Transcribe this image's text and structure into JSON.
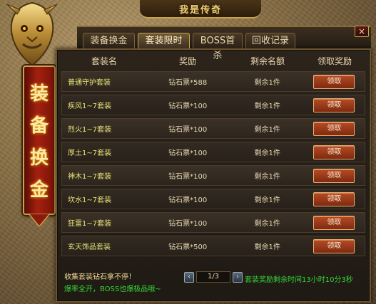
{
  "top_title": "我是传奇",
  "banner_chars": [
    "装",
    "备",
    "换",
    "金"
  ],
  "close_label": "×",
  "tabs": [
    {
      "label": "装备换金",
      "active": false
    },
    {
      "label": "套装限时",
      "active": true
    },
    {
      "label": "BOSS首杀",
      "active": false
    },
    {
      "label": "回收记录",
      "active": false
    }
  ],
  "table": {
    "headers": [
      "套装名",
      "奖励",
      "剩余名额",
      "领取奖励"
    ],
    "rows": [
      {
        "name": "普通守护套装",
        "reward": "钻石票*588",
        "remaining": "剩余1件",
        "button": "领取"
      },
      {
        "name": "疾风1~7套装",
        "reward": "钻石票*100",
        "remaining": "剩余1件",
        "button": "领取"
      },
      {
        "name": "烈火1~7套装",
        "reward": "钻石票*100",
        "remaining": "剩余1件",
        "button": "领取"
      },
      {
        "name": "厚土1~7套装",
        "reward": "钻石票*100",
        "remaining": "剩余1件",
        "button": "领取"
      },
      {
        "name": "神木1~7套装",
        "reward": "钻石票*100",
        "remaining": "剩余1件",
        "button": "领取"
      },
      {
        "name": "坎水1~7套装",
        "reward": "钻石票*100",
        "remaining": "剩余1件",
        "button": "领取"
      },
      {
        "name": "狂雷1~7套装",
        "reward": "钻石票*100",
        "remaining": "剩余1件",
        "button": "领取"
      },
      {
        "name": "玄天饰品套装",
        "reward": "钻石票*500",
        "remaining": "剩余1件",
        "button": "领取"
      }
    ]
  },
  "footer": {
    "msg1": "收集套装钻石拿不停！",
    "msg2": "爆率全开，BOSS也爆极品哦~",
    "page": "1/3",
    "prev": "‹",
    "next": "›",
    "timer": "套装奖励剩余时间13小时10分3秒"
  },
  "colors": {
    "accent_gold": "#c9a24a",
    "name_yellow": "#e9e47a",
    "green_text": "#36d63a",
    "button_red": "#b64b24"
  }
}
